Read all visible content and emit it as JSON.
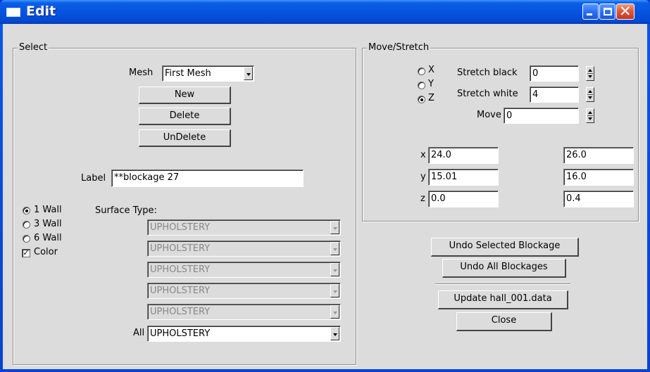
{
  "window": {
    "title": "Edit"
  },
  "select": {
    "group_title": "Select",
    "mesh_label": "Mesh",
    "mesh_value": "First Mesh",
    "new_label": "New",
    "delete_label": "Delete",
    "undelete_label": "UnDelete",
    "label_label": "Label",
    "label_value": "**blockage 27",
    "wall_options": [
      "1 Wall",
      "3 Wall",
      "6 Wall"
    ],
    "selected_wall": "1 Wall",
    "color_label": "Color",
    "color_checked": true,
    "surface_type_label": "Surface Type:",
    "surfaces": [
      "UPHOLSTERY",
      "UPHOLSTERY",
      "UPHOLSTERY",
      "UPHOLSTERY",
      "UPHOLSTERY"
    ],
    "all_label": "All",
    "all_value": "UPHOLSTERY"
  },
  "move": {
    "group_title": "Move/Stretch",
    "axis_options": [
      "X",
      "Y",
      "Z"
    ],
    "selected_axis": "Z",
    "stretch_black_label": "Stretch black",
    "stretch_black_value": "0",
    "stretch_white_label": "Stretch white",
    "stretch_white_value": "4",
    "move_label": "Move",
    "move_value": "0",
    "coords": [
      {
        "axis": "x",
        "min": "24.0",
        "max": "26.0"
      },
      {
        "axis": "y",
        "min": "15.01",
        "max": "16.0"
      },
      {
        "axis": "z",
        "min": "0.0",
        "max": "0.4"
      }
    ]
  },
  "actions": {
    "undo_selected": "Undo Selected Blockage",
    "undo_all": "Undo All Blockages",
    "update": "Update hall_001.data",
    "close": "Close"
  }
}
